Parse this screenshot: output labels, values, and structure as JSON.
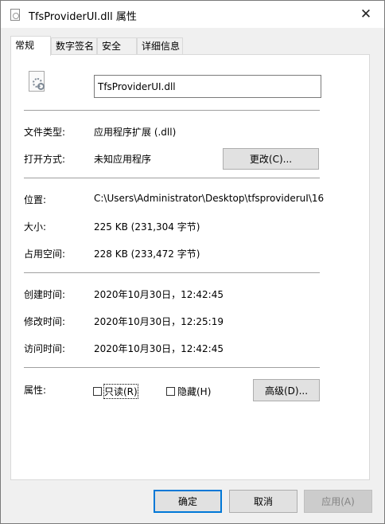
{
  "window": {
    "title": "TfsProviderUI.dll 属性",
    "close_glyph": "✕"
  },
  "tabs": [
    {
      "label": "常规",
      "active": true
    },
    {
      "label": "数字签名",
      "active": false
    },
    {
      "label": "安全",
      "active": false
    },
    {
      "label": "详细信息",
      "active": false
    }
  ],
  "general": {
    "file_name": "TfsProviderUI.dll",
    "file_icon": "dll-file-icon",
    "type_label": "文件类型:",
    "type_value": "应用程序扩展 (.dll)",
    "opens_with_label": "打开方式:",
    "opens_with_value": "未知应用程序",
    "change_button": "更改(C)...",
    "location_label": "位置:",
    "location_value": "C:\\Users\\Administrator\\Desktop\\tfsprovideruI\\16",
    "size_label": "大小:",
    "size_value": "225 KB (231,304 字节)",
    "size_on_disk_label": "占用空间:",
    "size_on_disk_value": "228 KB (233,472 字节)",
    "created_label": "创建时间:",
    "created_value": "2020年10月30日，12:42:45",
    "modified_label": "修改时间:",
    "modified_value": "2020年10月30日，12:25:19",
    "accessed_label": "访问时间:",
    "accessed_value": "2020年10月30日，12:42:45",
    "attributes_label": "属性:",
    "readonly_label": "只读(R)",
    "readonly_checked": false,
    "hidden_label": "隐藏(H)",
    "hidden_checked": false,
    "advanced_button": "高级(D)..."
  },
  "footer": {
    "ok": "确定",
    "cancel": "取消",
    "apply": "应用(A)"
  },
  "colors": {
    "accent": "#0078d7",
    "panel_bg": "#ffffff",
    "window_bg": "#f0f0f0"
  }
}
